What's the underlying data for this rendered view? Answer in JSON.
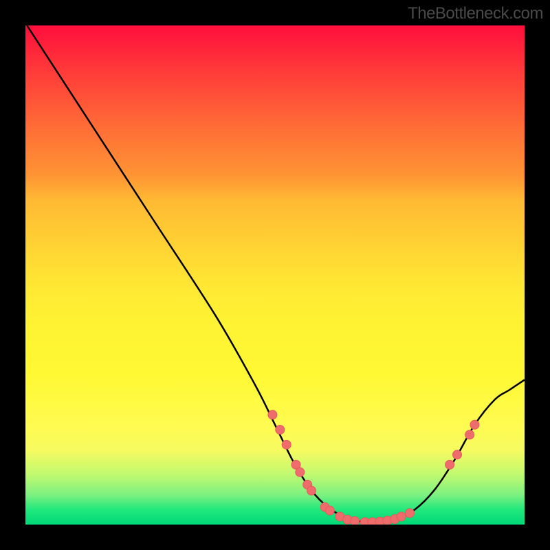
{
  "watermark": "TheBottleneck.com",
  "chart_data": {
    "type": "line",
    "title": "",
    "xlabel": "",
    "ylabel": "",
    "xlim": [
      0,
      100
    ],
    "ylim": [
      0,
      100
    ],
    "curve": [
      {
        "x": 0.3,
        "y": 100
      },
      {
        "x": 12,
        "y": 82
      },
      {
        "x": 25,
        "y": 62
      },
      {
        "x": 38,
        "y": 42
      },
      {
        "x": 46,
        "y": 28
      },
      {
        "x": 50,
        "y": 20
      },
      {
        "x": 54,
        "y": 12
      },
      {
        "x": 58,
        "y": 6
      },
      {
        "x": 62,
        "y": 2.5
      },
      {
        "x": 66,
        "y": 0.8
      },
      {
        "x": 70,
        "y": 0.5
      },
      {
        "x": 74,
        "y": 1
      },
      {
        "x": 78,
        "y": 3
      },
      {
        "x": 82,
        "y": 7
      },
      {
        "x": 86,
        "y": 13
      },
      {
        "x": 90,
        "y": 20
      },
      {
        "x": 94,
        "y": 25
      },
      {
        "x": 97,
        "y": 27
      },
      {
        "x": 100,
        "y": 29
      }
    ],
    "markers": [
      {
        "x": 49.5,
        "y": 22
      },
      {
        "x": 51,
        "y": 19
      },
      {
        "x": 52.3,
        "y": 16
      },
      {
        "x": 54.2,
        "y": 12
      },
      {
        "x": 55,
        "y": 10.5
      },
      {
        "x": 56.5,
        "y": 8
      },
      {
        "x": 57.3,
        "y": 6.8
      },
      {
        "x": 60,
        "y": 3.5
      },
      {
        "x": 61,
        "y": 2.8
      },
      {
        "x": 63,
        "y": 1.6
      },
      {
        "x": 64.5,
        "y": 1
      },
      {
        "x": 66,
        "y": 0.7
      },
      {
        "x": 68,
        "y": 0.5
      },
      {
        "x": 69.5,
        "y": 0.5
      },
      {
        "x": 71,
        "y": 0.6
      },
      {
        "x": 72.5,
        "y": 0.8
      },
      {
        "x": 74,
        "y": 1.1
      },
      {
        "x": 75.3,
        "y": 1.6
      },
      {
        "x": 77,
        "y": 2.3
      },
      {
        "x": 85,
        "y": 12
      },
      {
        "x": 86.5,
        "y": 14
      },
      {
        "x": 89,
        "y": 18
      },
      {
        "x": 90,
        "y": 20
      }
    ],
    "colors": {
      "curve": "#000000",
      "marker_fill": "#ee6c6c",
      "marker_stroke": "#e55a5a"
    }
  }
}
